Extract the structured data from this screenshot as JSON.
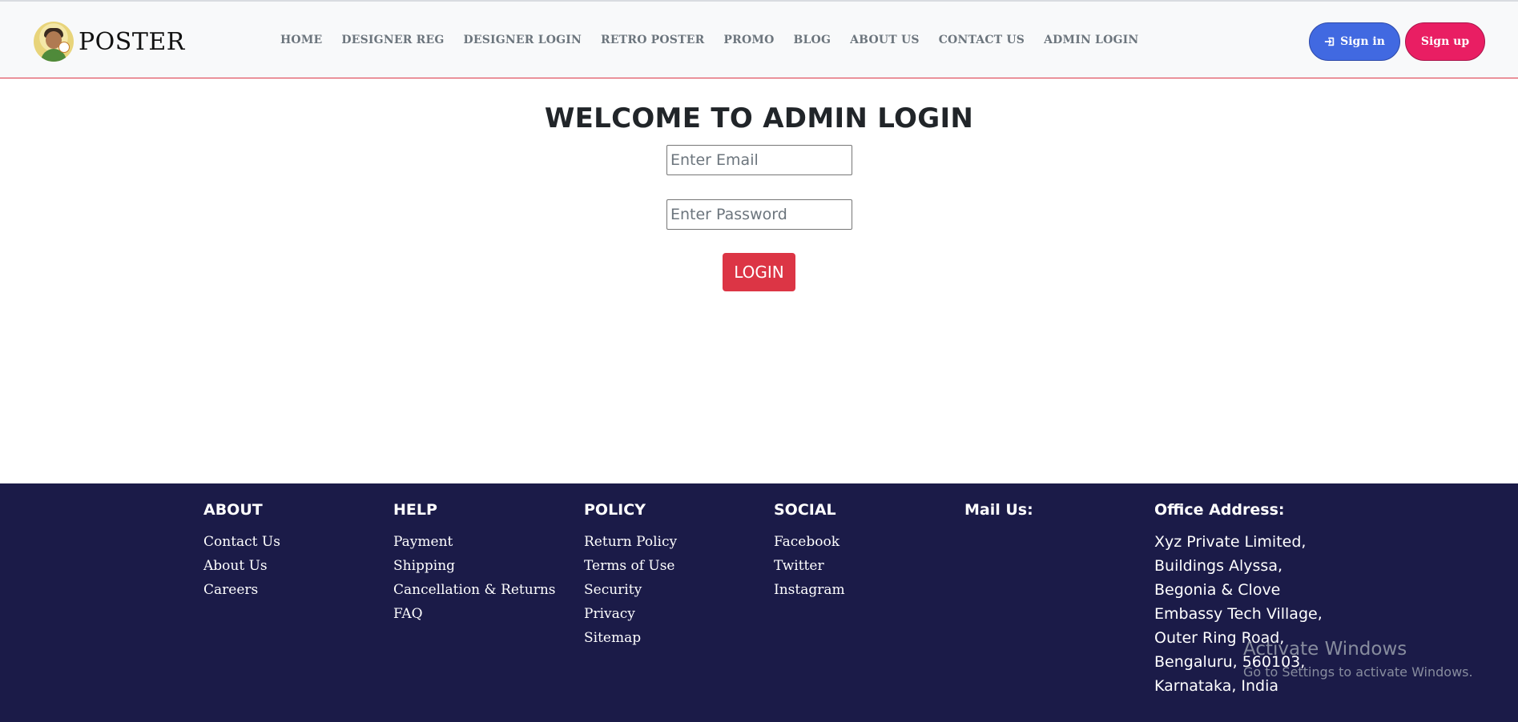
{
  "header": {
    "brand": "POSTER",
    "nav": [
      "HOME",
      "DESIGNER REG",
      "DESIGNER LOGIN",
      "RETRO POSTER",
      "PROMO",
      "BLOG",
      "ABOUT US",
      "CONTACT US",
      "ADMIN LOGIN"
    ],
    "signin_label": "Sign in",
    "signup_label": "Sign up"
  },
  "main": {
    "title": "WELCOME TO ADMIN LOGIN",
    "email_placeholder": "Enter Email",
    "password_placeholder": "Enter Password",
    "login_label": "LOGIN"
  },
  "footer": {
    "about": {
      "heading": "ABOUT",
      "items": [
        "Contact Us",
        "About Us",
        "Careers"
      ]
    },
    "help": {
      "heading": "HELP",
      "items": [
        "Payment",
        "Shipping",
        "Cancellation & Returns",
        "FAQ"
      ]
    },
    "policy": {
      "heading": "POLICY",
      "items": [
        "Return Policy",
        "Terms of Use",
        "Security",
        "Privacy",
        "Sitemap"
      ]
    },
    "social": {
      "heading": "SOCIAL",
      "items": [
        "Facebook",
        "Twitter",
        "Instagram"
      ]
    },
    "mail": {
      "heading": "Mail Us:"
    },
    "office": {
      "heading": "Office Address:",
      "lines": [
        "Xyz Private Limited,",
        "Buildings Alyssa,",
        "Begonia & Clove",
        "Embassy Tech Village,",
        "Outer Ring Road,",
        "Bengaluru, 560103,",
        "Karnataka, India"
      ]
    }
  },
  "watermark": {
    "line1": "Activate Windows",
    "line2": "Go to Settings to activate Windows."
  },
  "colors": {
    "signin": "#4169e1",
    "signup": "#e91e63",
    "login": "#dc3545",
    "footer_bg": "#1b1b48"
  }
}
